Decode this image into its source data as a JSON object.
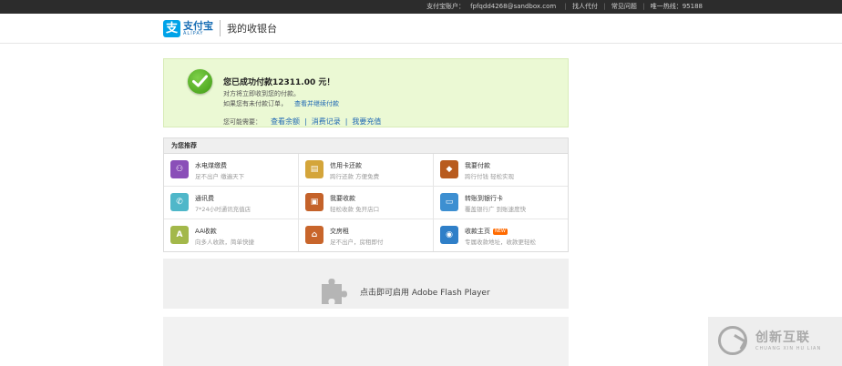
{
  "topbar": {
    "account_label": "支付宝账户：",
    "account": "fpfqdd4268@sandbox.com",
    "find_agent": "找人代付",
    "faq": "常见问题",
    "hotline": "唯一热线：95188"
  },
  "header": {
    "logo_mark": "支",
    "logo_cn": "支付宝",
    "logo_en": "ALIPAY",
    "title": "我的收银台"
  },
  "success": {
    "title": "您已成功付款12311.00 元！",
    "line1": "对方将立即收到您的付款。",
    "line2": "如果您有未付款订单，",
    "line2_link": "查看并继续付款",
    "need_label": "您可能需要：",
    "actions": [
      "查看余额",
      "消费记录",
      "我要充值"
    ]
  },
  "recommend": {
    "heading": "为您推荐",
    "items": [
      {
        "title": "水电煤缴费",
        "desc": "足不出户 缴遍天下",
        "icon": "utilities-icon",
        "color": "#8a4fb8",
        "glyph": "⚇"
      },
      {
        "title": "信用卡还款",
        "desc": "跨行还款 方便免费",
        "icon": "credit-card-icon",
        "color": "#d4a53a",
        "glyph": "▤"
      },
      {
        "title": "我要付款",
        "desc": "跨行付钱 轻松实现",
        "icon": "pay-icon",
        "color": "#b85b1e",
        "glyph": "◆"
      },
      {
        "title": "通讯费",
        "desc": "7*24小时通讯充值店",
        "icon": "phone-icon",
        "color": "#4fb7c9",
        "glyph": "✆"
      },
      {
        "title": "我要收款",
        "desc": "轻松收款 免开店口",
        "icon": "receive-icon",
        "color": "#c4622a",
        "glyph": "▣"
      },
      {
        "title": "转账到银行卡",
        "desc": "覆盖银行广 到账速度快",
        "icon": "bank-transfer-icon",
        "color": "#3d8fd1",
        "glyph": "▭"
      },
      {
        "title": "AA收款",
        "desc": "向多人收款，简单快捷",
        "icon": "aa-icon",
        "color": "#a3b84a",
        "glyph": "A"
      },
      {
        "title": "交房租",
        "desc": "足不出户，房租即付",
        "icon": "rent-icon",
        "color": "#c8652b",
        "glyph": "⌂"
      },
      {
        "title": "收款主页",
        "desc": "专属收款地址，收款更轻松",
        "icon": "homepage-icon",
        "color": "#2f7fc8",
        "glyph": "◉",
        "badge": "NEW"
      }
    ]
  },
  "flash": {
    "text": "点击即可启用 Adobe Flash Player"
  },
  "watermark": {
    "cn": "创新互联",
    "en": "CHUANG XIN HU LIAN"
  }
}
